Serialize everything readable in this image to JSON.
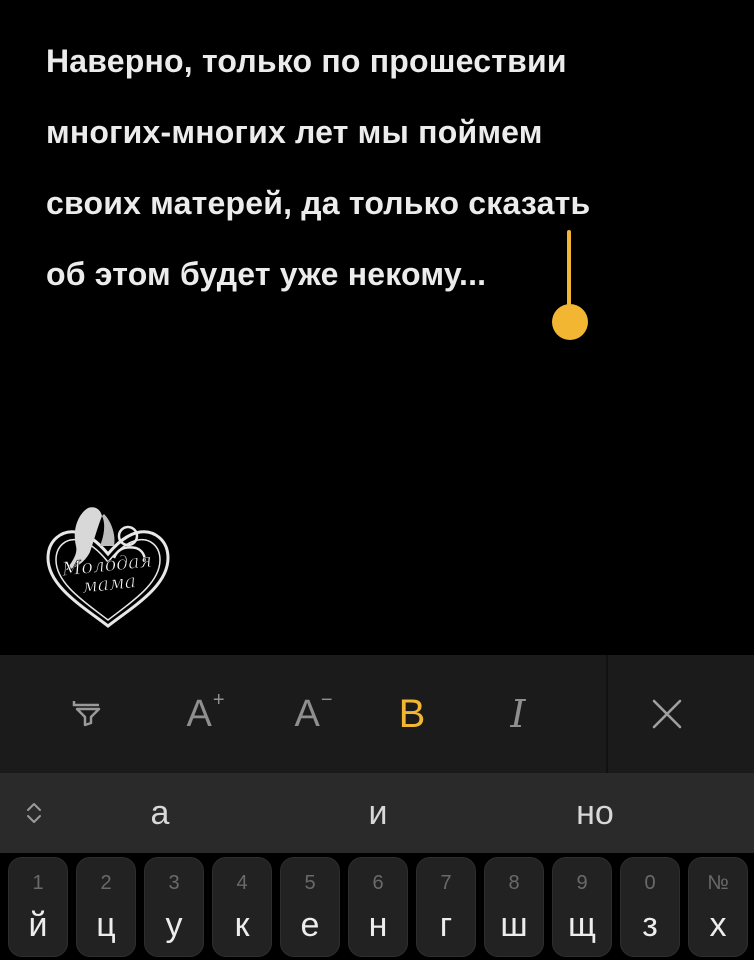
{
  "note": {
    "lines": [
      "Наверно, только по прошествии",
      "многих-многих лет мы поймем",
      "своих матерей, да только сказать",
      "об этом будет уже некому..."
    ]
  },
  "logo": {
    "text_line1": "Молодая",
    "text_line2": "мама"
  },
  "toolbar": {
    "highlight_icon": "highlighter-icon",
    "increase_font_label": "A",
    "increase_font_sup": "+",
    "decrease_font_label": "A",
    "decrease_font_sup": "−",
    "bold_label": "B",
    "italic_label": "I",
    "close_icon": "close-icon",
    "accent_color": "#f2b632"
  },
  "suggestions": {
    "expand_icon": "chevron-up-down-icon",
    "words": [
      "а",
      "и",
      "но"
    ]
  },
  "keyboard": {
    "keys": [
      {
        "num": "1",
        "char": "й"
      },
      {
        "num": "2",
        "char": "ц"
      },
      {
        "num": "3",
        "char": "у"
      },
      {
        "num": "4",
        "char": "к"
      },
      {
        "num": "5",
        "char": "е"
      },
      {
        "num": "6",
        "char": "н"
      },
      {
        "num": "7",
        "char": "г"
      },
      {
        "num": "8",
        "char": "ш"
      },
      {
        "num": "9",
        "char": "щ"
      },
      {
        "num": "0",
        "char": "з"
      },
      {
        "num": "№",
        "char": "х"
      }
    ]
  }
}
